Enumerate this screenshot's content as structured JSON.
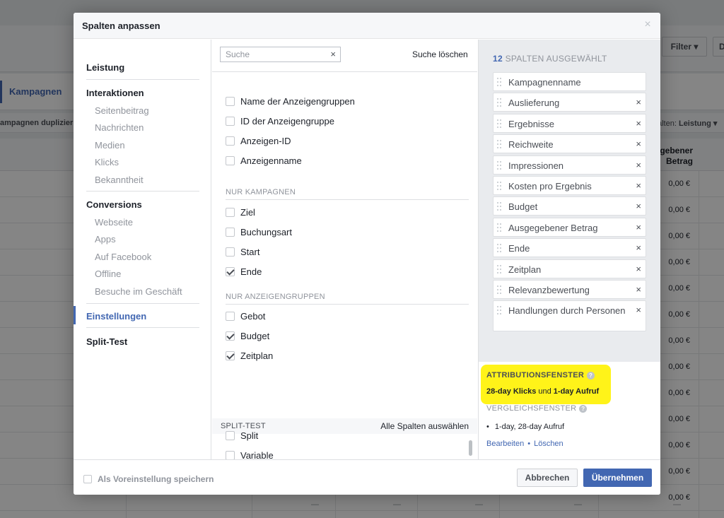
{
  "background": {
    "filter_label": "Filter ▾",
    "filter2_label": "D",
    "tab_label": "Kampagnen",
    "actions_left": "ampagnen duplizier",
    "actions_right_prefix": "alten: ",
    "actions_right_value": "Leistung ▾",
    "column_header_line1": "gebener",
    "column_header_line2": "Betrag",
    "row_values": [
      "0,00 €",
      "0,00 €",
      "0,00 €",
      "0,00 €",
      "0,00 €",
      "0,00 €",
      "0,00 €",
      "0,00 €",
      "0,00 €",
      "0,00 €",
      "0,00 €",
      "0,00 €",
      "0,00 €"
    ],
    "footer_dashes": [
      "—",
      "—",
      "—",
      "—",
      "—"
    ]
  },
  "dialog": {
    "title": "Spalten anpassen",
    "close": "×"
  },
  "nav": {
    "leistung": "Leistung",
    "interaktionen": "Interaktionen",
    "interaktionen_items": [
      "Seitenbeitrag",
      "Nachrichten",
      "Medien",
      "Klicks",
      "Bekanntheit"
    ],
    "conversions": "Conversions",
    "conversions_items": [
      "Webseite",
      "Apps",
      "Auf Facebook",
      "Offline",
      "Besuche im Geschäft"
    ],
    "einstellungen": "Einstellungen",
    "split_test": "Split-Test"
  },
  "search": {
    "placeholder": "Suche",
    "value": "",
    "clear_icon": "×",
    "clear_label": "Suche löschen"
  },
  "options": {
    "group_top": [
      {
        "label": "Name der Anzeigengruppen",
        "checked": false
      },
      {
        "label": "ID der Anzeigengruppe",
        "checked": false
      },
      {
        "label": "Anzeigen-ID",
        "checked": false
      },
      {
        "label": "Anzeigenname",
        "checked": false
      }
    ],
    "campaigns_heading": "NUR KAMPAGNEN",
    "campaigns": [
      {
        "label": "Ziel",
        "checked": false
      },
      {
        "label": "Buchungsart",
        "checked": false
      },
      {
        "label": "Start",
        "checked": false
      },
      {
        "label": "Ende",
        "checked": true
      }
    ],
    "adsets_heading": "NUR ANZEIGENGRUPPEN",
    "adsets": [
      {
        "label": "Gebot",
        "checked": false
      },
      {
        "label": "Budget",
        "checked": true
      },
      {
        "label": "Zeitplan",
        "checked": true
      }
    ],
    "split_heading": "SPLIT-TEST",
    "split_select_all": "Alle Spalten auswählen",
    "split": [
      {
        "label": "Split",
        "checked": false
      },
      {
        "label": "Variable",
        "checked": false
      }
    ]
  },
  "selected": {
    "count": "12",
    "count_label": "SPALTEN AUSGEWÄHLT",
    "remove_icon": "×",
    "columns": [
      "Kampagnenname",
      "Auslieferung",
      "Ergebnisse",
      "Reichweite",
      "Impressionen",
      "Kosten pro Ergebnis",
      "Budget",
      "Ausgegebener Betrag",
      "Ende",
      "Zeitplan",
      "Relevanzbewertung",
      "Handlungen durch Personen"
    ]
  },
  "attribution": {
    "title": "ATTRIBUTIONSFENSTER",
    "info_icon": "?",
    "value_part1": "28-day Klicks",
    "value_and": " und ",
    "value_part2": "1-day Aufruf",
    "compare_title": "VERGLEICHSFENSTER",
    "compare_item": "1-day, 28-day Aufruf",
    "edit_link": "Bearbeiten",
    "link_separator": "•",
    "delete_link": "Löschen",
    "highlight_color": "#fff200"
  },
  "footer": {
    "save_preset_label": "Als Voreinstellung speichern",
    "cancel_label": "Abbrechen",
    "apply_label": "Übernehmen"
  },
  "colors": {
    "accent": "#4267b2",
    "text": "#1d2129",
    "muted": "#90949c"
  }
}
